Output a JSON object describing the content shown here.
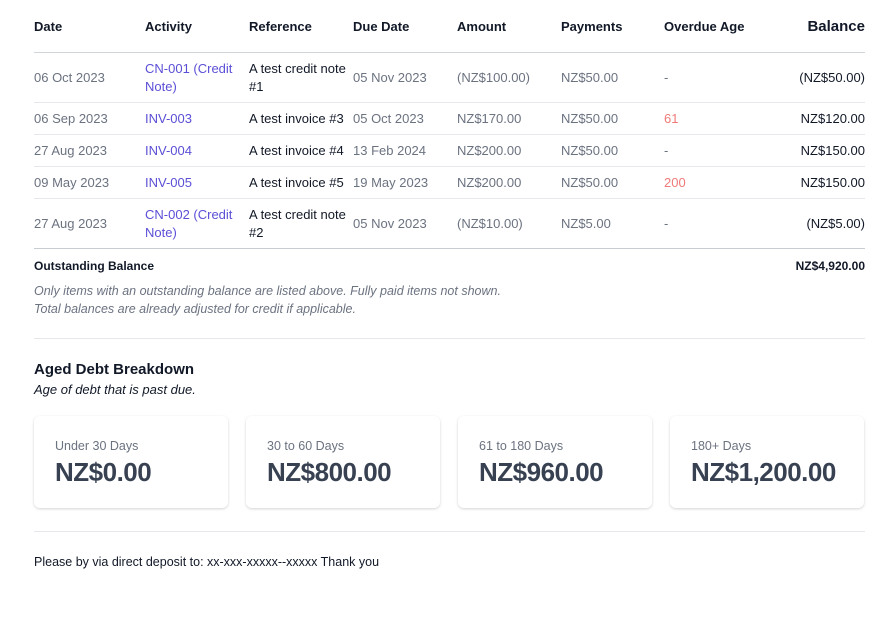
{
  "table": {
    "headers": {
      "date": "Date",
      "activity": "Activity",
      "reference": "Reference",
      "due_date": "Due Date",
      "amount": "Amount",
      "payments": "Payments",
      "overdue_age": "Overdue Age",
      "balance": "Balance"
    },
    "rows": [
      {
        "date": "06 Oct 2023",
        "activity": "CN-001 (Credit Note)",
        "reference": "A test credit note #1",
        "due_date": "05 Nov 2023",
        "amount": "(NZ$100.00)",
        "payments": "NZ$50.00",
        "overdue_age": "-",
        "balance": "(NZ$50.00)"
      },
      {
        "date": "06 Sep 2023",
        "activity": "INV-003",
        "reference": "A test invoice #3",
        "due_date": "05 Oct 2023",
        "amount": "NZ$170.00",
        "payments": "NZ$50.00",
        "overdue_age": "61",
        "balance": "NZ$120.00"
      },
      {
        "date": "27 Aug 2023",
        "activity": "INV-004",
        "reference": "A test invoice #4",
        "due_date": "13 Feb 2024",
        "amount": "NZ$200.00",
        "payments": "NZ$50.00",
        "overdue_age": "-",
        "balance": "NZ$150.00"
      },
      {
        "date": "09 May 2023",
        "activity": "INV-005",
        "reference": "A test invoice #5",
        "due_date": "19 May 2023",
        "amount": "NZ$200.00",
        "payments": "NZ$50.00",
        "overdue_age": "200",
        "balance": "NZ$150.00"
      },
      {
        "date": "27 Aug 2023",
        "activity": "CN-002 (Credit Note)",
        "reference": "A test credit note #2",
        "due_date": "05 Nov 2023",
        "amount": "(NZ$10.00)",
        "payments": "NZ$5.00",
        "overdue_age": "-",
        "balance": "(NZ$5.00)"
      }
    ]
  },
  "outstanding": {
    "label": "Outstanding Balance",
    "value": "NZ$4,920.00"
  },
  "notes": {
    "line1": "Only items with an outstanding balance are listed above. Fully paid items not shown.",
    "line2": "Total balances are already adjusted for credit if applicable."
  },
  "aged_debt": {
    "title": "Aged Debt Breakdown",
    "subtitle": "Age of debt that is past due.",
    "cards": [
      {
        "label": "Under 30 Days",
        "amount": "NZ$0.00"
      },
      {
        "label": "30 to 60 Days",
        "amount": "NZ$800.00"
      },
      {
        "label": "61 to 180 Days",
        "amount": "NZ$960.00"
      },
      {
        "label": "180+ Days",
        "amount": "NZ$1,200.00"
      }
    ]
  },
  "footer": {
    "payment_note": "Please by via direct deposit to: xx-xxx-xxxxx--xxxxx Thank you"
  },
  "colors": {
    "link": "#5b4fd6",
    "overdue": "#f07a7a",
    "muted": "#6b7280",
    "text": "#111827"
  }
}
